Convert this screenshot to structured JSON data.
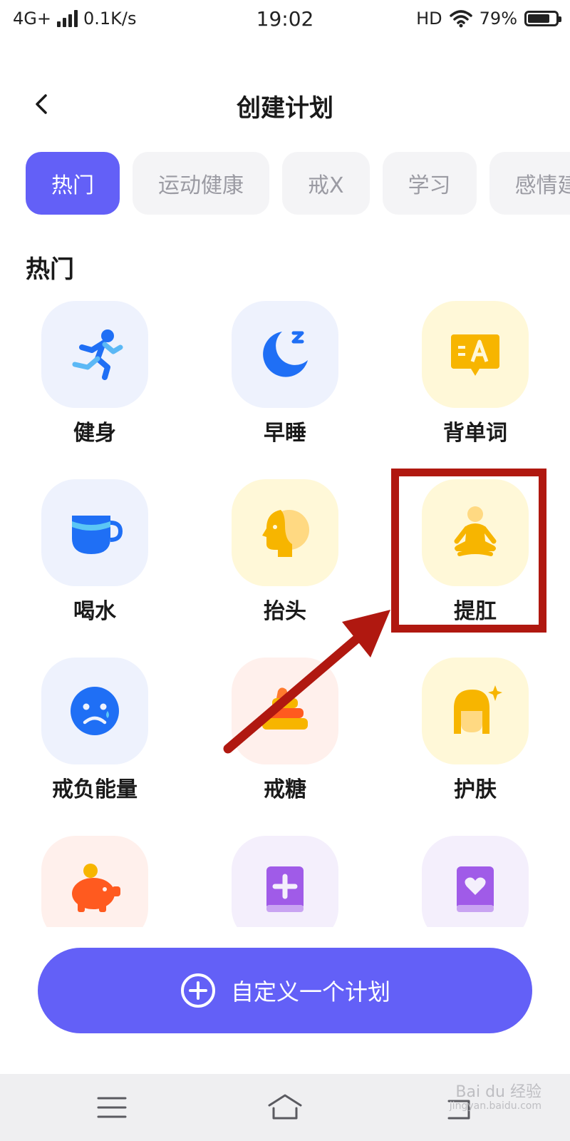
{
  "status_bar": {
    "network": "4G+",
    "speed": "0.1K/s",
    "time": "19:02",
    "hd": "HD",
    "battery_percent": "79%",
    "battery_level": 0.79
  },
  "header": {
    "back_icon": "chevron-left-icon",
    "title": "创建计划"
  },
  "tabs": [
    {
      "label": "热门",
      "active": true
    },
    {
      "label": "运动健康",
      "active": false
    },
    {
      "label": "戒X",
      "active": false
    },
    {
      "label": "学习",
      "active": false
    },
    {
      "label": "感情建",
      "active": false
    }
  ],
  "section_title": "热门",
  "plans": [
    {
      "label": "健身",
      "icon": "running-man-icon",
      "tile": "blue"
    },
    {
      "label": "早睡",
      "icon": "moon-sleep-icon",
      "tile": "blue"
    },
    {
      "label": "背单词",
      "icon": "vocabulary-card-icon",
      "tile": "yellow"
    },
    {
      "label": "喝水",
      "icon": "water-cup-icon",
      "tile": "blue"
    },
    {
      "label": "抬头",
      "icon": "head-up-icon",
      "tile": "yellow"
    },
    {
      "label": "提肛",
      "icon": "meditation-icon",
      "tile": "yellow"
    },
    {
      "label": "戒负能量",
      "icon": "sad-face-icon",
      "tile": "blue"
    },
    {
      "label": "戒糖",
      "icon": "cake-icon",
      "tile": "pink"
    },
    {
      "label": "护肤",
      "icon": "skincare-face-icon",
      "tile": "yellow"
    },
    {
      "label": "",
      "icon": "piggy-bank-icon",
      "tile": "pink"
    },
    {
      "label": "",
      "icon": "medical-book-icon",
      "tile": "purple"
    },
    {
      "label": "",
      "icon": "love-book-icon",
      "tile": "purple"
    }
  ],
  "custom_button": {
    "icon": "plus-circle-icon",
    "label": "自定义一个计划"
  },
  "nav_bar": {
    "menu_icon": "menu-icon",
    "home_icon": "home-icon",
    "back_icon": "back-nav-icon"
  },
  "watermark": {
    "text": "Bai du 经验",
    "sub": "jingyan.baidu.com"
  },
  "colors": {
    "accent": "#6360f7",
    "annotation": "#b01810",
    "tile_blue": "#eef2fd",
    "tile_yellow": "#fff8d8",
    "tile_pink": "#fff0ec",
    "tile_purple": "#f4effc"
  }
}
